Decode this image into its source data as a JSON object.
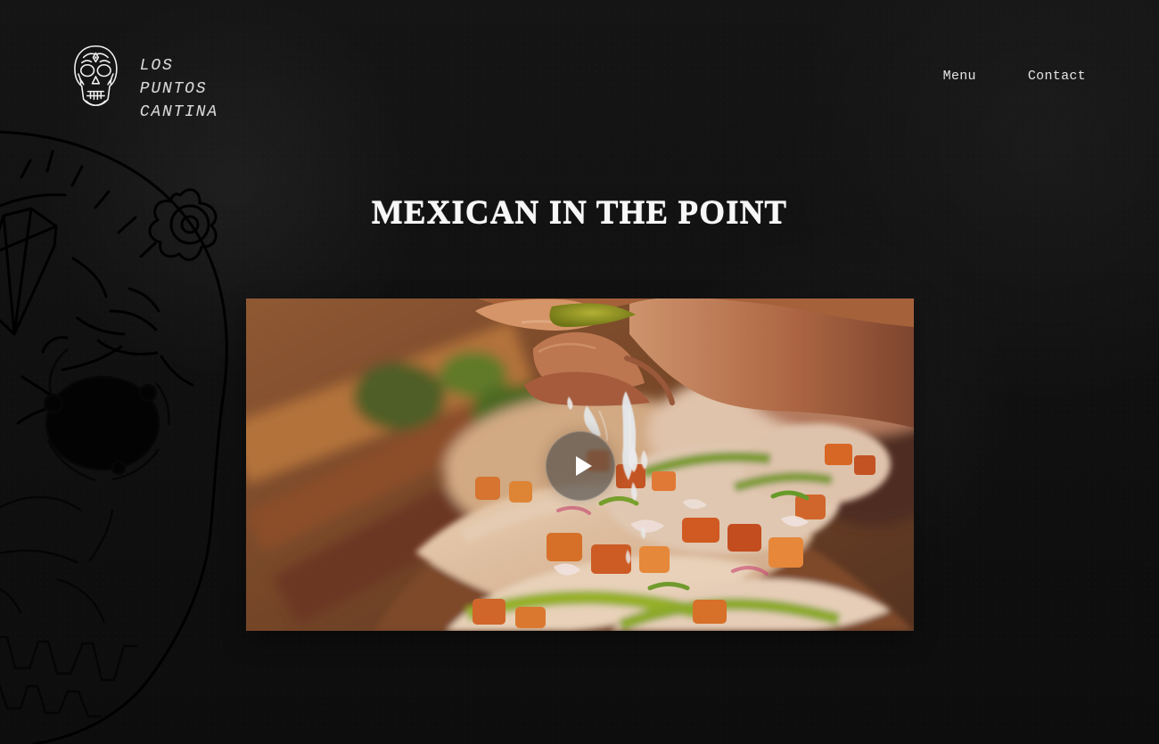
{
  "brand": {
    "logo_icon": "skull-icon",
    "line1": "LOS PUNTOS",
    "line2": "CANTINA"
  },
  "nav": {
    "menu": "Menu",
    "contact": "Contact"
  },
  "hero": {
    "title": "MEXICAN IN THE POINT",
    "play_icon": "play-icon"
  },
  "decor": {
    "side_art": "sugar-skull-illustration"
  },
  "colors": {
    "background": "#111111",
    "text": "#ffffff",
    "nav_text": "#e5e5e5",
    "play_overlay": "#464646"
  }
}
